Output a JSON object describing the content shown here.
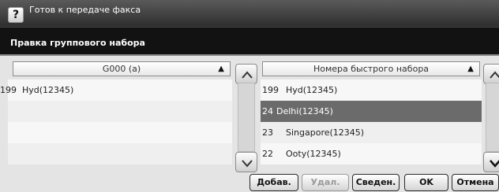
{
  "status": {
    "text": "Готов к передаче факса",
    "help_label": "?"
  },
  "title": "Правка группового набора",
  "left_list": {
    "header": "G000 (a)",
    "rows": [
      {
        "num": "199",
        "name": "Hyd(12345)"
      }
    ]
  },
  "right_list": {
    "header": "Номера быстрого набора",
    "rows": [
      {
        "num": "199",
        "name": "Hyd(12345)",
        "selected": false
      },
      {
        "num": "24",
        "name": "Delhi(12345)",
        "selected": true
      },
      {
        "num": "23",
        "name": "Singapore(12345)",
        "selected": false
      },
      {
        "num": "22",
        "name": "Ooty(12345)",
        "selected": false
      }
    ]
  },
  "buttons": {
    "add": "Добав.",
    "delete": "Удал.",
    "details": "Сведен.",
    "ok": "OK",
    "cancel": "Отмена"
  },
  "icons": {
    "sort": "triangle-up-icon",
    "scroll_up": "chevron-up-icon",
    "scroll_down": "chevron-down-icon"
  }
}
